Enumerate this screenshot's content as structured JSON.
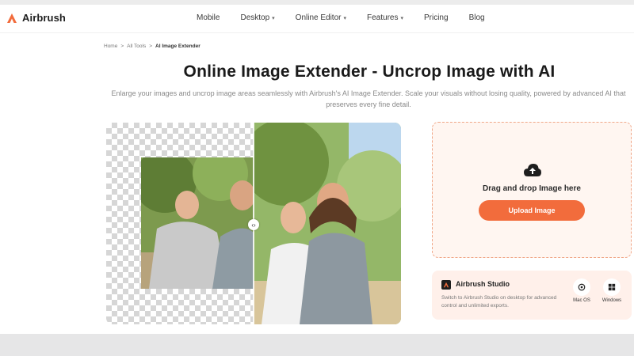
{
  "brand": {
    "name": "Airbrush",
    "accent": "#f26c3c"
  },
  "nav": {
    "items": [
      {
        "label": "Mobile",
        "dropdown": false
      },
      {
        "label": "Desktop",
        "dropdown": true
      },
      {
        "label": "Online Editor",
        "dropdown": true
      },
      {
        "label": "Features",
        "dropdown": true
      },
      {
        "label": "Pricing",
        "dropdown": false
      },
      {
        "label": "Blog",
        "dropdown": false
      }
    ]
  },
  "breadcrumb": {
    "home": "Home",
    "tools": "All Tools",
    "current": "AI Image Extender",
    "separator": ">"
  },
  "hero": {
    "title": "Online Image Extender - Uncrop Image with AI",
    "subtitle": "Enlarge your images and uncrop image areas seamlessly with Airbrush's AI Image Extender. Scale your visuals without losing quality, powered by advanced AI that preserves every fine detail."
  },
  "upload": {
    "icon": "cloud-upload-icon",
    "prompt": "Drag and drop Image here",
    "button": "Upload Image"
  },
  "studio": {
    "title": "Airbrush Studio",
    "description": "Switch to Airbrush Studio on desktop for advanced control and unlimited exports.",
    "platforms": [
      {
        "label": "Mac OS",
        "icon": "apple-icon"
      },
      {
        "label": "Windows",
        "icon": "windows-icon"
      }
    ]
  },
  "compare": {
    "handle_glyph": "‹›"
  }
}
